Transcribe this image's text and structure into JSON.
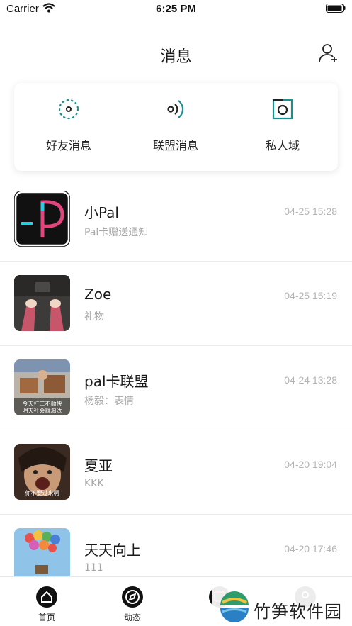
{
  "status_bar": {
    "carrier": "Carrier",
    "time": "6:25 PM"
  },
  "header": {
    "title": "消息",
    "add_friend_icon": "add-user-icon"
  },
  "categories": [
    {
      "label": "好友消息",
      "icon": "dotted-circle-icon"
    },
    {
      "label": "联盟消息",
      "icon": "broadcast-icon"
    },
    {
      "label": "私人域",
      "icon": "square-circle-icon"
    }
  ],
  "conversations": [
    {
      "name": "小Pal",
      "preview": "Pal卡赠送通知",
      "time": "04-25 15:28"
    },
    {
      "name": "Zoe",
      "preview": "礼物",
      "time": "04-25 15:19"
    },
    {
      "name": "pal卡联盟",
      "preview": "杨毅：表情",
      "time": "04-24 13:28"
    },
    {
      "name": "夏亚",
      "preview": "KKK",
      "time": "04-20 19:04"
    },
    {
      "name": "天天向上",
      "preview": "111",
      "time": "04-20 17:46"
    }
  ],
  "avatar_captions": {
    "pal_union": "今天打工不勤快\n明天社会就淘汰",
    "xiaya": "你不要过来啊"
  },
  "tabs": [
    {
      "label": "首页",
      "icon": "home-icon"
    },
    {
      "label": "动态",
      "icon": "compass-icon"
    },
    {
      "label": "",
      "icon": "message-icon"
    },
    {
      "label": "",
      "icon": "profile-icon"
    }
  ],
  "watermark": {
    "text": "竹笋软件园"
  },
  "colors": {
    "accent_teal": "#1a8f8f",
    "dark": "#111111",
    "pal_pink": "#e0457b",
    "pal_cyan": "#2fc9e0"
  }
}
